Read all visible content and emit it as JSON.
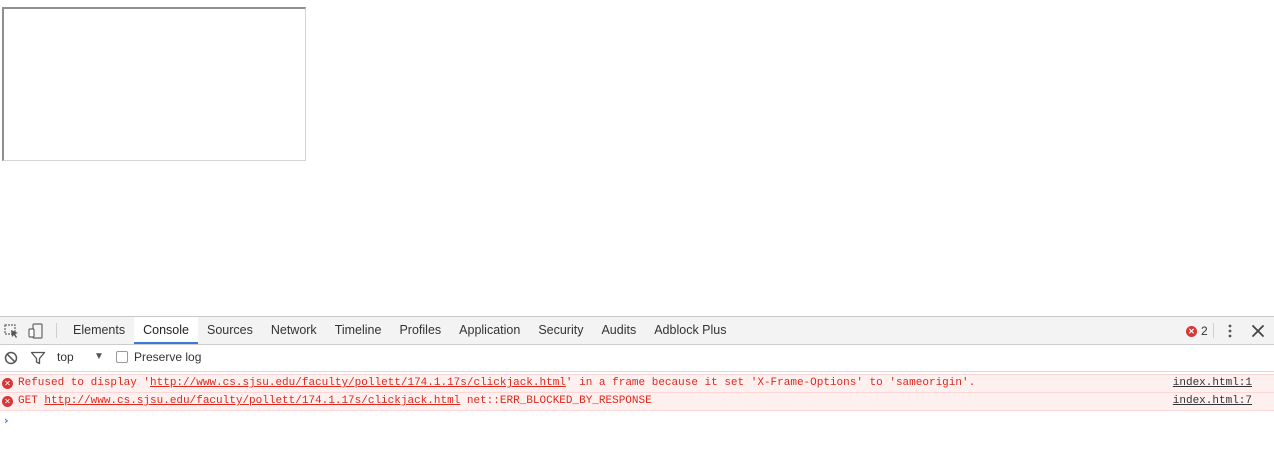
{
  "devtools": {
    "tabs": [
      {
        "label": "Elements"
      },
      {
        "label": "Console",
        "active": true
      },
      {
        "label": "Sources"
      },
      {
        "label": "Network"
      },
      {
        "label": "Timeline"
      },
      {
        "label": "Profiles"
      },
      {
        "label": "Application"
      },
      {
        "label": "Security"
      },
      {
        "label": "Audits"
      },
      {
        "label": "Adblock Plus"
      }
    ],
    "error_count": "2",
    "filter": {
      "context": "top",
      "preserve_log_label": "Preserve log"
    },
    "messages": [
      {
        "prefix": "Refused to display '",
        "url": "http://www.cs.sjsu.edu/faculty/pollett/174.1.17s/clickjack.html",
        "suffix": "' in a frame because it set 'X-Frame-Options' to 'sameorigin'.",
        "source": "index.html:1"
      },
      {
        "prefix": "GET ",
        "url": "http://www.cs.sjsu.edu/faculty/pollett/174.1.17s/clickjack.html",
        "suffix": " net::ERR_BLOCKED_BY_RESPONSE",
        "source": "index.html:7"
      }
    ],
    "prompt_symbol": "›"
  },
  "colors": {
    "accent": "#3879d9",
    "error": "#e0281d",
    "error_bg": "#fff0f0"
  }
}
